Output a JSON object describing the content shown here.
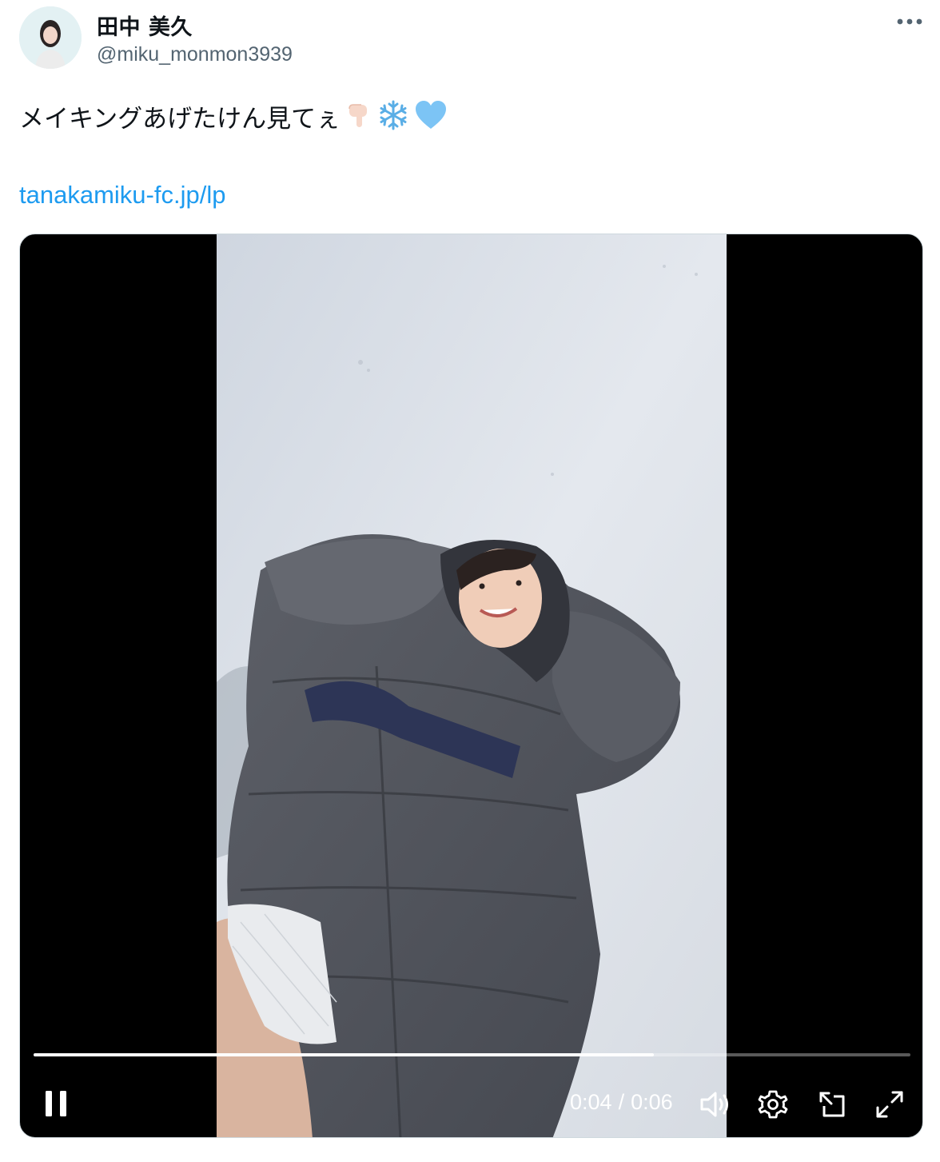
{
  "author": {
    "display_name": "田中 美久",
    "handle": "@miku_monmon3939",
    "avatar_icon": "profile-photo"
  },
  "more_icon": "more-horizontal-icon",
  "tweet": {
    "text": "メイキングあげたけん見てぇ",
    "emojis": [
      "backhand-index-pointing-down",
      "snowflake",
      "light-blue-heart"
    ],
    "link": "tanakamiku-fc.jp/lp"
  },
  "video": {
    "current_time": "0:04",
    "separator": "/",
    "duration": "0:06",
    "progress_fraction": 0.707,
    "controls": {
      "pause_icon": "pause-icon",
      "volume_icon": "volume-icon",
      "settings_icon": "gear-icon",
      "pip_icon": "picture-in-picture-icon",
      "fullscreen_icon": "fullscreen-icon"
    }
  },
  "colors": {
    "link": "#1d9bf0",
    "handle": "#536471",
    "text": "#0f1419",
    "heart": "#7cc4f5",
    "snowflake": "#5aaee6"
  }
}
